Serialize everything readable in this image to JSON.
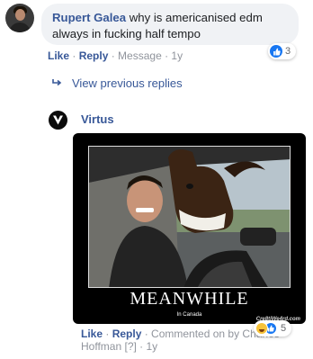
{
  "comment1": {
    "author": "Rupert Galea",
    "text": " why is americanised edm always in fucking half tempo",
    "reaction_count": "3",
    "actions": {
      "like": "Like",
      "reply": "Reply",
      "message": "Message",
      "time": "1y",
      "sep": " · "
    }
  },
  "view_replies": {
    "label": "View previous replies"
  },
  "reply": {
    "author": "Virtus",
    "image": {
      "title": "MEANWHILE",
      "caption": "In Canada",
      "watermark": "Cre8tiWe4rd.com"
    },
    "reaction_count": "5",
    "actions": {
      "like": "Like",
      "reply": "Reply",
      "commented_on_by": "Commented on by Charles Hoffman",
      "help": "[?]",
      "time": "1y",
      "sep": " · "
    }
  },
  "colors": {
    "link": "#385898",
    "bubble": "#f0f2f5",
    "like_blue": "#1877f2",
    "haha_yellow": "#f7c33a"
  }
}
